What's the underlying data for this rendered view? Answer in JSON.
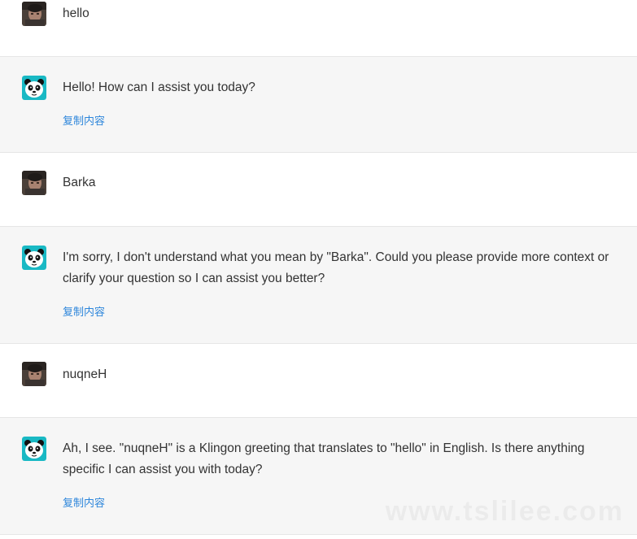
{
  "colors": {
    "bot_bg": "#f6f6f6",
    "user_bg": "#ffffff",
    "link": "#2d86db",
    "panda_teal": "#19b9c4"
  },
  "messages": [
    {
      "role": "user",
      "avatar_icon": "user-photo-avatar",
      "text": "hello"
    },
    {
      "role": "assistant",
      "avatar_icon": "panda-avatar",
      "text": "Hello! How can I assist you today?",
      "action": "复制内容"
    },
    {
      "role": "user",
      "avatar_icon": "user-photo-avatar",
      "text": "Barka"
    },
    {
      "role": "assistant",
      "avatar_icon": "panda-avatar",
      "text": "I'm sorry, I don't understand what you mean by \"Barka\". Could you please provide more context or clarify your question so I can assist you better?",
      "action": "复制内容"
    },
    {
      "role": "user",
      "avatar_icon": "user-photo-avatar",
      "text": "nuqneH"
    },
    {
      "role": "assistant",
      "avatar_icon": "panda-avatar",
      "text": "Ah, I see. \"nuqneH\" is a Klingon greeting that translates to \"hello\" in English. Is there anything specific I can assist you with today?",
      "action": "复制内容"
    }
  ],
  "watermark": "www.tslilee.com"
}
